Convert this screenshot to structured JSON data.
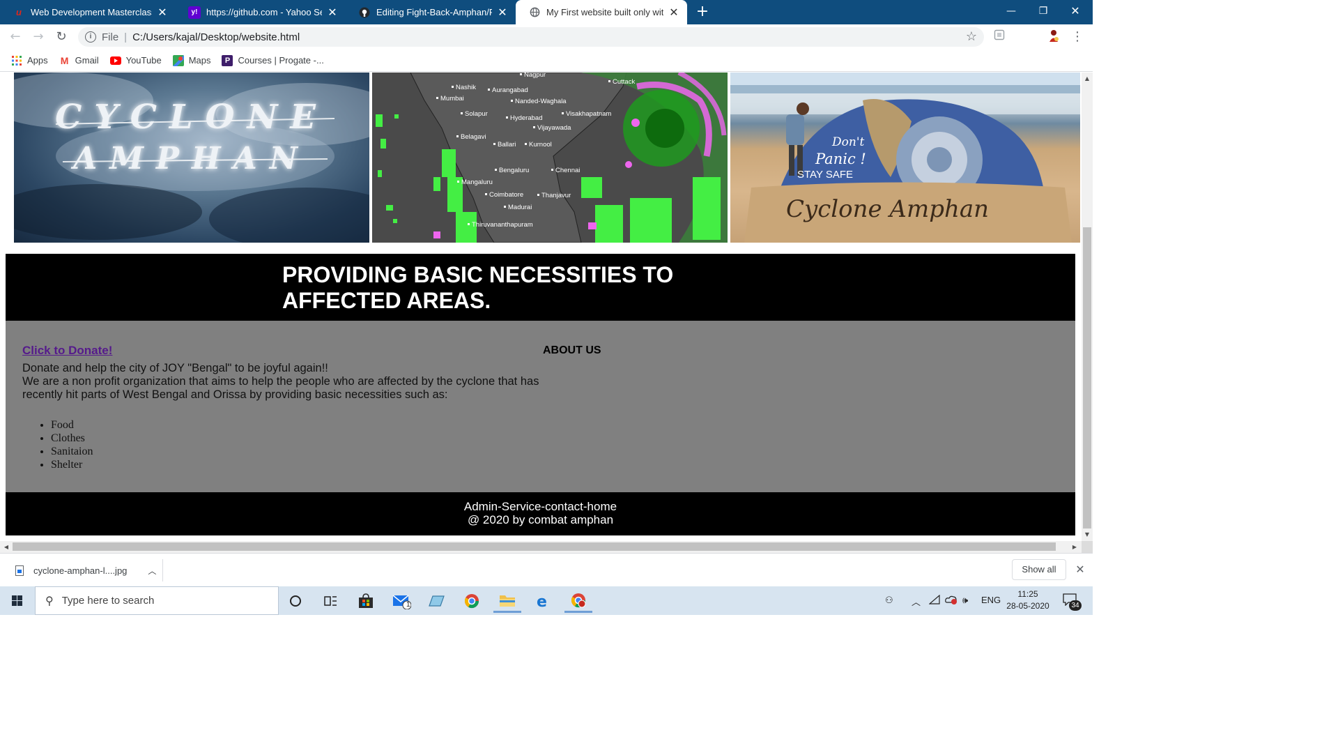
{
  "browser": {
    "tabs": [
      {
        "title": "Web Development Masterclass -",
        "favicon": "u",
        "favicon_color": "#e0271b",
        "active": false
      },
      {
        "title": "https://github.com - Yahoo Search",
        "favicon": "y!",
        "favicon_color": "#6001d2",
        "active": false
      },
      {
        "title": "Editing Fight-Back-Amphan/README",
        "favicon": "github",
        "favicon_color": "#24292e",
        "active": false
      },
      {
        "title": "My First website built only with HTML",
        "favicon": "globe",
        "favicon_color": "#5f6368",
        "active": true
      }
    ],
    "new_tab": "+",
    "minimize": "—",
    "maximize": "❐",
    "close": "✕",
    "url_scheme": "File",
    "url": "C:/Users/kajal/Desktop/website.html",
    "bookmarks": [
      {
        "label": "Apps",
        "icon": "apps-grid-icon"
      },
      {
        "label": "Gmail",
        "icon": "gmail-icon"
      },
      {
        "label": "YouTube",
        "icon": "youtube-icon"
      },
      {
        "label": "Maps",
        "icon": "maps-icon"
      },
      {
        "label": "Courses | Progate -...",
        "icon": "progate-icon"
      }
    ]
  },
  "page": {
    "hero_images": [
      {
        "caption_lines": [
          "CYCLONE",
          "AMPHAN"
        ]
      },
      {
        "map_labels": [
          "Nagpur",
          "Nashik",
          "Aurangabad",
          "Mumbai",
          "Nanded-Waghala",
          "Cuttack",
          "Solapur",
          "Hyderabad",
          "Visakhapatnam",
          "Vijayawada",
          "Belagavi",
          "Ballari",
          "Kurnool",
          "Bengaluru",
          "Chennai",
          "Mangaluru",
          "Coimbatore",
          "Thanjavur",
          "Madurai",
          "Thiruvananthapuram"
        ]
      },
      {
        "sand_text": [
          "Don't",
          "Panic !",
          "STAY SAFE",
          "Cyclone Amphan"
        ]
      }
    ],
    "banner_title": "PROVIDING BASIC NECESSITIES TO AFFECTED AREAS.",
    "donate_link": "Click to Donate!",
    "intro_line1": "Donate and help the city of JOY \"Bengal\" to be joyful again!!",
    "intro_line2": "We are a non profit organization that aims to help the people who are affected by the cyclone that has recently hit parts of West Bengal and Orissa by providing basic necessities such as:",
    "needs": [
      "Food",
      "Clothes",
      "Sanitaion",
      "Shelter"
    ],
    "about_heading": "ABOUT US",
    "footer_links": "Admin-Service-contact-home",
    "footer_copyright": "@ 2020 by combat amphan"
  },
  "downloads": {
    "file": "cyclone-amphan-l....jpg",
    "show_all": "Show all"
  },
  "taskbar": {
    "search_placeholder": "Type here to search",
    "mail_badge": "1",
    "language": "ENG",
    "time": "11:25",
    "date": "28-05-2020",
    "notifications": "34"
  }
}
